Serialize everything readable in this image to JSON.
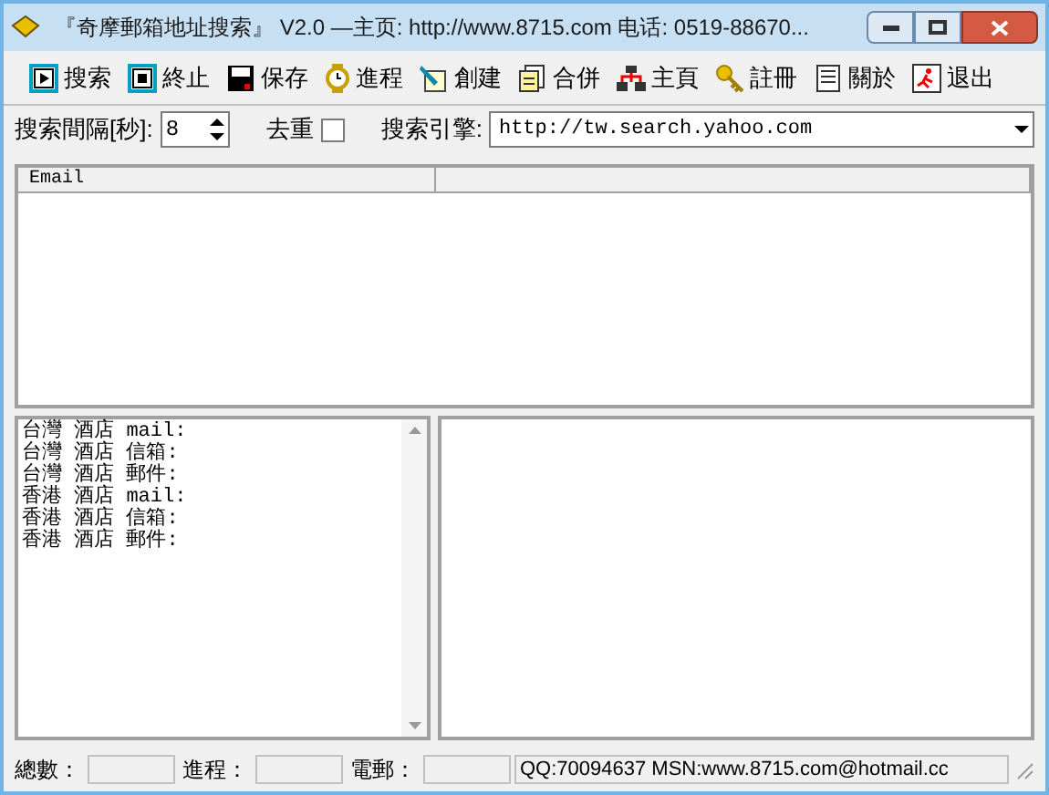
{
  "window": {
    "title": "『奇摩郵箱地址搜索』 V2.0  —主页: http://www.8715.com 电话: 0519-88670..."
  },
  "toolbar": [
    {
      "label": "搜索",
      "kind": "play"
    },
    {
      "label": "終止",
      "kind": "stop"
    },
    {
      "label": "保存",
      "kind": "save"
    },
    {
      "label": "進程",
      "kind": "watch"
    },
    {
      "label": "創建",
      "kind": "create"
    },
    {
      "label": "合併",
      "kind": "merge"
    },
    {
      "label": "主頁",
      "kind": "home"
    },
    {
      "label": "註冊",
      "kind": "key"
    },
    {
      "label": "關於",
      "kind": "about"
    },
    {
      "label": "退出",
      "kind": "exit"
    }
  ],
  "options": {
    "interval_label": "搜索間隔[秒]:",
    "interval_value": "8",
    "dedupe_label": "去重",
    "dedupe_checked": false,
    "engine_label": "搜索引擎:",
    "engine_value": "http://tw.search.yahoo.com"
  },
  "table": {
    "columns": [
      "Email",
      ""
    ]
  },
  "keywords": [
    "台灣 酒店 mail:",
    "台灣 酒店 信箱:",
    "台灣 酒店 郵件:",
    "香港 酒店 mail:",
    "香港 酒店 信箱:",
    "香港 酒店 郵件:"
  ],
  "status_bar": {
    "total_label": "總數：",
    "progress_label": "進程：",
    "email_label": "電郵：",
    "contact": "QQ:70094637 MSN:www.8715.com@hotmail.cc"
  }
}
